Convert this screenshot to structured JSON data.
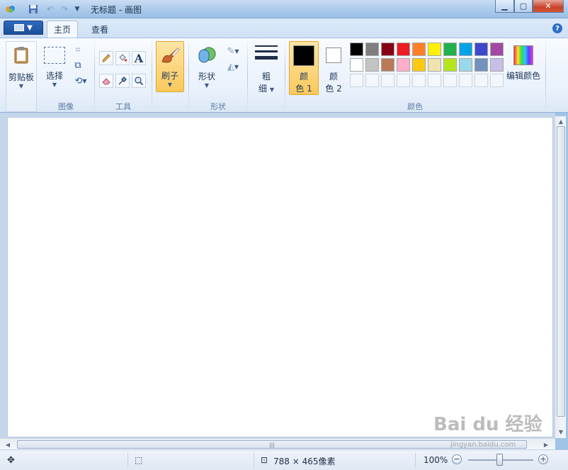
{
  "window": {
    "title": "无标题 - 画图"
  },
  "tabs": [
    {
      "label": "主页",
      "active": true
    },
    {
      "label": "查看",
      "active": false
    }
  ],
  "ribbon": {
    "clipboard": {
      "label": "剪贴板"
    },
    "select": {
      "label": "选择"
    },
    "group_image": "图像",
    "group_tools": "工具",
    "brush": {
      "label": "刷子"
    },
    "shapes": {
      "label": "形状"
    },
    "group_shapes": "形状",
    "size": {
      "label_1": "粗",
      "label_2": "细"
    },
    "color1": {
      "label_1": "颜",
      "label_2": "色 1",
      "color": "#000000"
    },
    "color2": {
      "label_1": "颜",
      "label_2": "色 2",
      "color": "#ffffff"
    },
    "edit_colors": {
      "label": "编辑颜色"
    },
    "group_colors": "颜色",
    "palette": [
      [
        "#000000",
        "#7f7f7f",
        "#880015",
        "#ed1c24",
        "#ff7f27",
        "#fff200",
        "#22b14c",
        "#00a2e8",
        "#3f48cc",
        "#a349a4"
      ],
      [
        "#ffffff",
        "#c3c3c3",
        "#b97a57",
        "#ffaec9",
        "#ffc90e",
        "#efe4b0",
        "#b5e61d",
        "#99d9ea",
        "#7092be",
        "#c8bfe7"
      ]
    ]
  },
  "statusbar": {
    "dimensions": "788 × 465像素",
    "zoom": "100%"
  },
  "watermark": {
    "text": "Bai du 经验",
    "url": "jingyan.baidu.com"
  },
  "colors": {
    "accent": "#fbc95b",
    "window_frame": "#a9c8ea"
  }
}
